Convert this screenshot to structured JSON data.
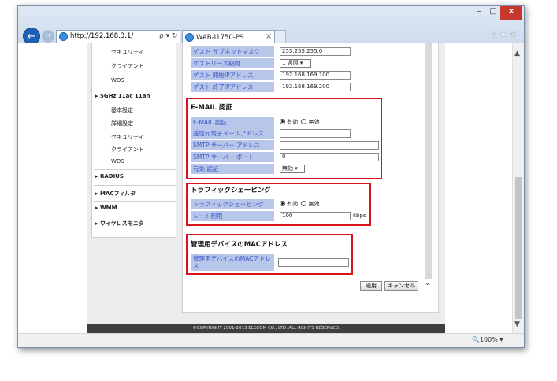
{
  "browser": {
    "address_prefix": "http://",
    "address_host": "192.168.3.1/",
    "address_controls": "ρ ▾ ↻",
    "tab_title": "WAB-I1750-PS",
    "tab_close": "×",
    "zoom": "100%",
    "zoom_icon": "magnifier-icon",
    "window_controls": {
      "min": "–",
      "max": "□",
      "close": "×"
    },
    "toolbar_icons": [
      "home-icon",
      "star-icon",
      "gear-icon"
    ]
  },
  "sidebar": {
    "items": [
      {
        "label": "セキュリティ",
        "level": "sub"
      },
      {
        "label": "クライアント",
        "level": "sub"
      },
      {
        "label": "WDS",
        "level": "sub"
      },
      {
        "label": "▸ 5GHz 11ac 11an",
        "level": "main"
      },
      {
        "label": "基本設定",
        "level": "sub"
      },
      {
        "label": "詳細設定",
        "level": "sub"
      },
      {
        "label": "セキュリティ",
        "level": "sub"
      },
      {
        "label": "クライアント",
        "level": "sub"
      },
      {
        "label": "WDS",
        "level": "sub"
      },
      {
        "label": "▸ RADIUS",
        "level": "main"
      },
      {
        "label": "▸ MACフィルタ",
        "level": "main"
      },
      {
        "label": "▸ WMM",
        "level": "main"
      },
      {
        "label": "▸ ワイヤレスモニタ",
        "level": "main"
      }
    ]
  },
  "guest": {
    "rows": [
      {
        "label": "ゲスト サブネットマスク",
        "value": "255.255.255.0"
      },
      {
        "label": "ゲストリース期間",
        "value": "1 週間 ▾"
      },
      {
        "label": "ゲスト 開始IPアドレス",
        "value": "192.168.169.100"
      },
      {
        "label": "ゲスト 終了IPアドレス",
        "value": "192.168.169.200"
      }
    ]
  },
  "email": {
    "title": "E-MAIL 認証",
    "auth_label": "E-MAIL 認証",
    "on": "有効",
    "off": "無効",
    "sender_label": "送信元電子メールアドレス",
    "sender_value": "",
    "smtp_addr_label": "SMTP サーバー アドレス",
    "smtp_addr_value": "",
    "smtp_port_label": "SMTP サーバー ポート",
    "smtp_port_value": "0",
    "enable_auth_label": "有効 認証",
    "enable_auth_value": "無効 ▾"
  },
  "traffic": {
    "title": "トラフィックシェーピング",
    "shaping_label": "トラフィックシェーピング",
    "on": "有効",
    "off": "無効",
    "rate_label": "レート制限",
    "rate_value": "100",
    "rate_unit": "kbps"
  },
  "mgmt": {
    "title": "管理用デバイスのMACアドレス",
    "mac_label": "管理用デバイスのMACアドレス",
    "mac_value": ""
  },
  "actions": {
    "apply": "適用",
    "cancel": "キャンセル",
    "more": "⌄"
  },
  "footer": {
    "text": "©COPYRIGHT 2001-2013 ELECOM CO., LTD. ALL RIGHTS RESERVED."
  },
  "colors": {
    "highlight": "#d6141b",
    "label_bg": "#b7c6e9",
    "label_text": "#3a56c8"
  }
}
